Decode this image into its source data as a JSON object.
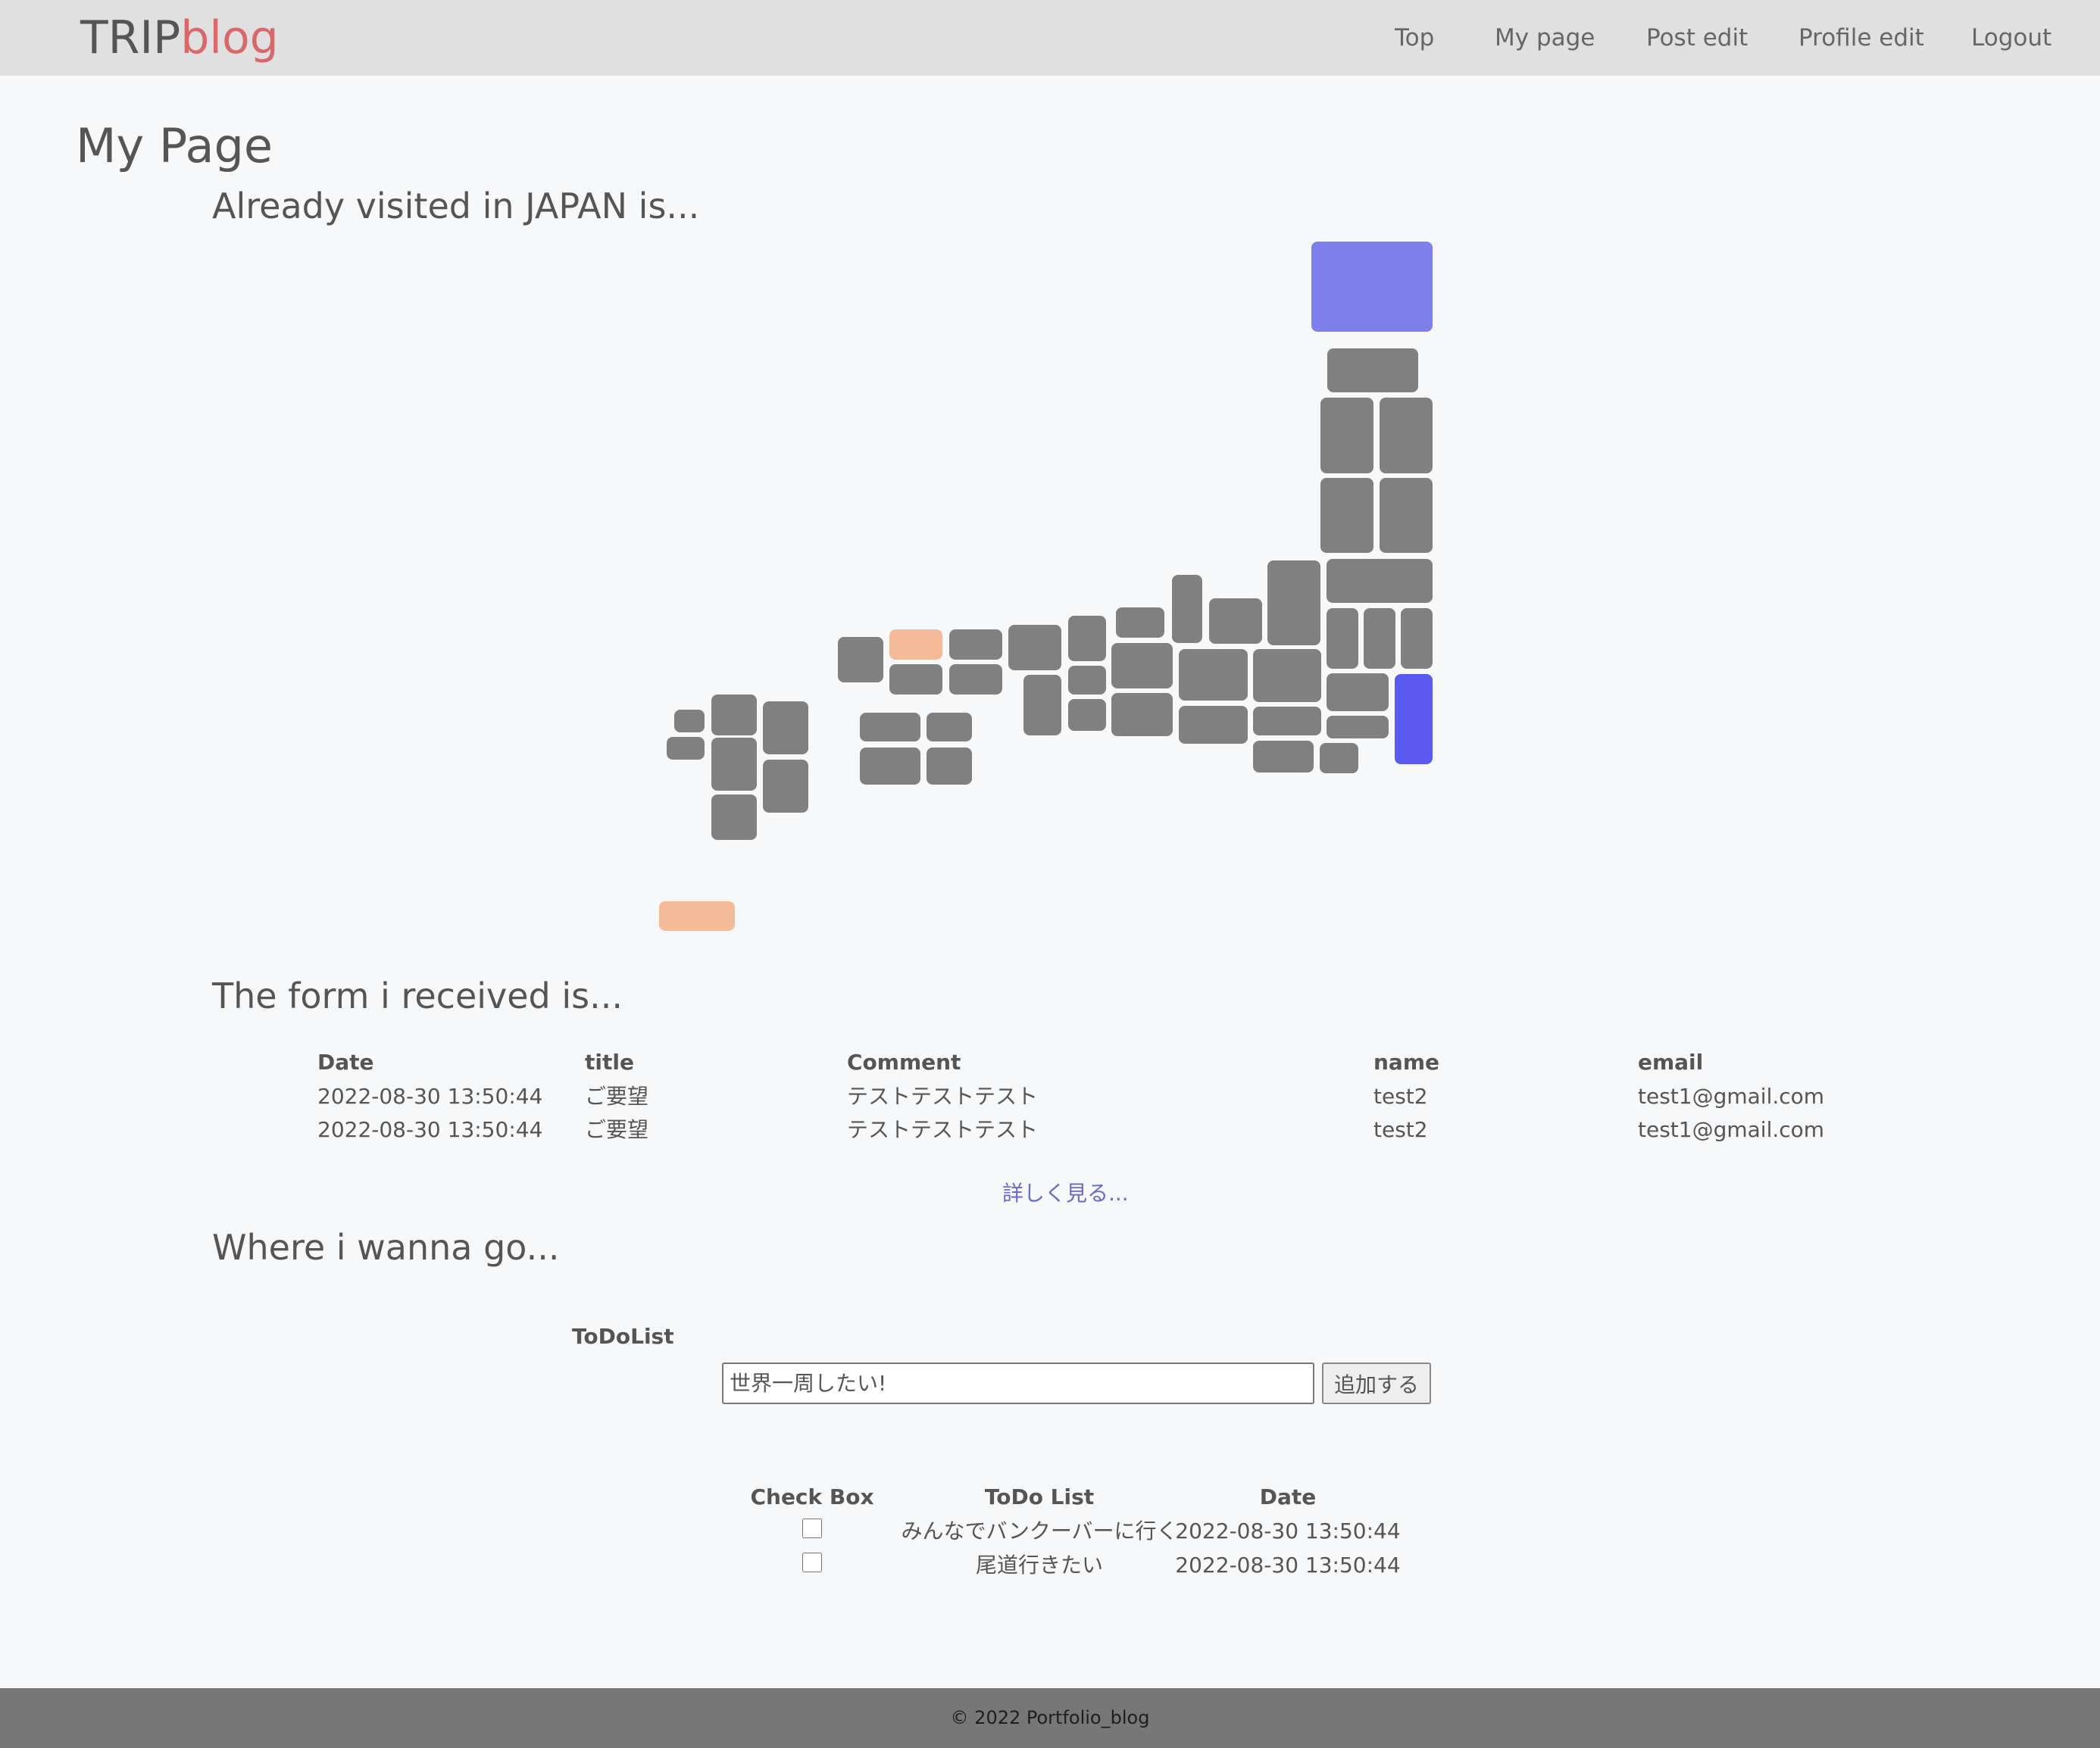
{
  "navbar": {
    "brand_trip": "TRIP",
    "brand_blog": "blog",
    "links": [
      "Top",
      "My page",
      "Post edit",
      "Profile edit",
      "Logout"
    ]
  },
  "page_title": "My Page",
  "visited_section": {
    "title": "Already visited in JAPAN is...",
    "colors": {
      "unvisited": "#808080",
      "peach": "#f5bb98",
      "violet": "#8080ec",
      "blue": "#5a5af0"
    }
  },
  "form_section": {
    "title": "The form i received is...",
    "headers": [
      "Date",
      "title",
      "Comment",
      "name",
      "email"
    ],
    "rows": [
      [
        "2022-08-30 13:50:44",
        "ご要望",
        "テストテストテスト",
        "test2",
        "test1@gmail.com"
      ],
      [
        "2022-08-30 13:50:44",
        "ご要望",
        "テストテストテスト",
        "test2",
        "test1@gmail.com"
      ]
    ],
    "more_link": "詳しく見る..."
  },
  "wanna_section": {
    "title": "Where i wanna go...",
    "todo_label": "ToDoList",
    "input_placeholder": "世界一周したい!",
    "add_button": "追加する",
    "headers": [
      "Check Box",
      "ToDo List",
      "Date"
    ],
    "rows": [
      {
        "checked": false,
        "text": "みんなでバンクーバーに行く",
        "date": "2022-08-30 13:50:44"
      },
      {
        "checked": false,
        "text": "尾道行きたい",
        "date": "2022-08-30 13:50:44"
      }
    ]
  },
  "footer": {
    "text": "© 2022 Portfolio_blog"
  },
  "accent_colors": {
    "brand_blog": "#d9686a",
    "link": "#6a6ac8",
    "navbar_bg": "#e0e0e0",
    "footer_bg": "#777777"
  }
}
